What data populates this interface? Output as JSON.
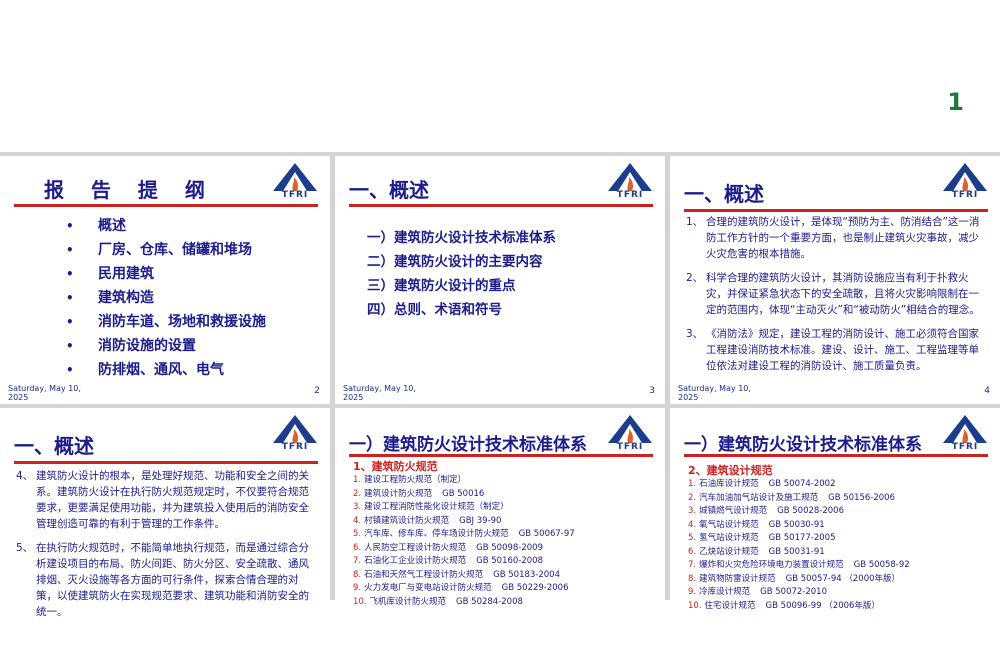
{
  "page_number": "1",
  "date": "Saturday, May 10, 2025",
  "logo_text": "TFRI",
  "slides": [
    {
      "title": "报 告 提 纲",
      "number": "2",
      "bullets": [
        "概述",
        "厂房、仓库、储罐和堆场",
        "民用建筑",
        "建筑构造",
        "消防车道、场地和救援设施",
        "消防设施的设置",
        "防排烟、通风、电气"
      ]
    },
    {
      "title": "一、概述",
      "number": "3",
      "items": [
        "一）建筑防火设计技术标准体系",
        "二）建筑防火设计的主要内容",
        "三）建筑防火设计的重点",
        "四）总则、术语和符号"
      ]
    },
    {
      "title": "一、概述",
      "number": "4",
      "paragraphs": [
        {
          "num": "1、",
          "text": "合理的建筑防火设计，是体现“预防为主、防消结合”这一消防工作方针的一个重要方面，也是制止建筑火灾事故，减少火灾危害的根本措施。"
        },
        {
          "num": "2、",
          "text": "科学合理的建筑防火设计，其消防设施应当有利于扑救火灾，并保证紧急状态下的安全疏散，且将火灾影响限制在一定的范围内，体现“主动灭火”和“被动防火”相结合的理念。"
        },
        {
          "num": "3、",
          "text": "《消防法》规定，建设工程的消防设计、施工必须符合国家工程建设消防技术标准。建设、设计、施工、工程监理等单位依法对建设工程的消防设计、施工质量负责。"
        }
      ]
    },
    {
      "title": "一、概述",
      "number": "",
      "paragraphs": [
        {
          "num": "4、",
          "text": "建筑防火设计的根本，是处理好规范、功能和安全之间的关系。建筑防火设计在执行防火规范规定时，不仅要符合规范要求，更要满足使用功能，并为建筑投入使用后的消防安全管理创造可靠的有利于管理的工作条件。"
        },
        {
          "num": "5、",
          "text": "在执行防火规范时，不能简单地执行规范，而是通过综合分析建设项目的布局、防火间距、防火分区、安全疏散、通风排烟、灭火设施等各方面的可行条件，探索合情合理的对策，以使建筑防火在实现规范要求、建筑功能和消防安全的统一。"
        }
      ]
    },
    {
      "title": "一）建筑防火设计技术标准体系",
      "number": "",
      "sub_heading": "1、建筑防火规范",
      "codes": [
        {
          "num": "1.",
          "name": "建设工程防火规范（制定）",
          "code": ""
        },
        {
          "num": "2.",
          "name": "建筑设计防火规范",
          "code": "GB 50016"
        },
        {
          "num": "3.",
          "name": "建设工程消防性能化设计规范（制定）",
          "code": ""
        },
        {
          "num": "4.",
          "name": "村镇建筑设计防火规范",
          "code": "GBJ 39-90"
        },
        {
          "num": "5.",
          "name": "汽车库、修车库、停车场设计防火规范",
          "code": "GB 50067-97"
        },
        {
          "num": "6.",
          "name": "人民防空工程设计防火规范",
          "code": "GB 50098-2009"
        },
        {
          "num": "7.",
          "name": "石油化工企业设计防火规范",
          "code": "GB 50160-2008"
        },
        {
          "num": "8.",
          "name": "石油和天然气工程设计防火规范",
          "code": "GB 50183-2004"
        },
        {
          "num": "9.",
          "name": "火力发电厂与变电站设计防火规范",
          "code": "GB 50229-2006"
        },
        {
          "num": "10.",
          "name": "飞机库设计防火规范",
          "code": "GB 50284-2008"
        }
      ]
    },
    {
      "title": "一）建筑防火设计技术标准体系",
      "number": "",
      "sub_heading": "2、建筑设计规范",
      "codes": [
        {
          "num": "1.",
          "name": "石油库设计规范",
          "code": "GB 50074-2002"
        },
        {
          "num": "2.",
          "name": "汽车加油加气站设计及施工规范",
          "code": "GB 50156-2006"
        },
        {
          "num": "3.",
          "name": "城镇燃气设计规范",
          "code": "GB 50028-2006"
        },
        {
          "num": "4.",
          "name": "氧气站设计规范",
          "code": "GB 50030-91"
        },
        {
          "num": "5.",
          "name": "氢气站设计规范",
          "code": "GB 50177-2005"
        },
        {
          "num": "6.",
          "name": "乙炔站设计规范",
          "code": "GB 50031-91"
        },
        {
          "num": "7.",
          "name": "爆炸和火灾危险环境电力装置设计规范",
          "code": "GB 50058-92"
        },
        {
          "num": "8.",
          "name": "建筑物防雷设计规范",
          "code": "GB 50057-94 （2000年版）"
        },
        {
          "num": "9.",
          "name": "冷库设计规范",
          "code": "GB 50072-2010"
        },
        {
          "num": "10.",
          "name": "住宅设计规范",
          "code": "GB 50096-99 （2006年版）"
        }
      ]
    }
  ]
}
